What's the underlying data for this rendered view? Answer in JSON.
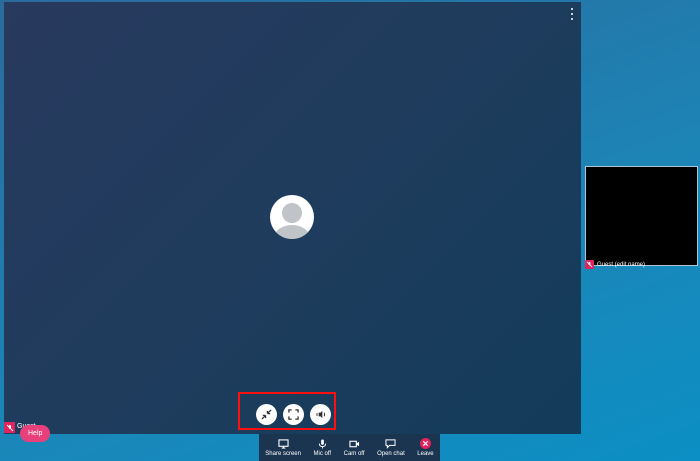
{
  "main": {
    "menu_icon": "kebab-menu-icon",
    "avatar_icon": "default-avatar-icon",
    "controls": [
      {
        "icon": "minimize-icon"
      },
      {
        "icon": "fullscreen-icon"
      },
      {
        "icon": "volume-icon"
      }
    ]
  },
  "participant": {
    "name": "Guest (edit name)",
    "mic_status_icon": "mic-off-icon"
  },
  "self": {
    "name": "Guest",
    "mic_status_icon": "mic-off-icon"
  },
  "help": {
    "label": "Help"
  },
  "toolbar": {
    "share_screen": "Share screen",
    "mic_off": "Mic off",
    "cam_off": "Cam off",
    "open_chat": "Open chat",
    "leave": "Leave"
  },
  "colors": {
    "highlight_border": "#ff1010",
    "accent": "#e0245e",
    "toolbar_bg": "#1b3550"
  }
}
